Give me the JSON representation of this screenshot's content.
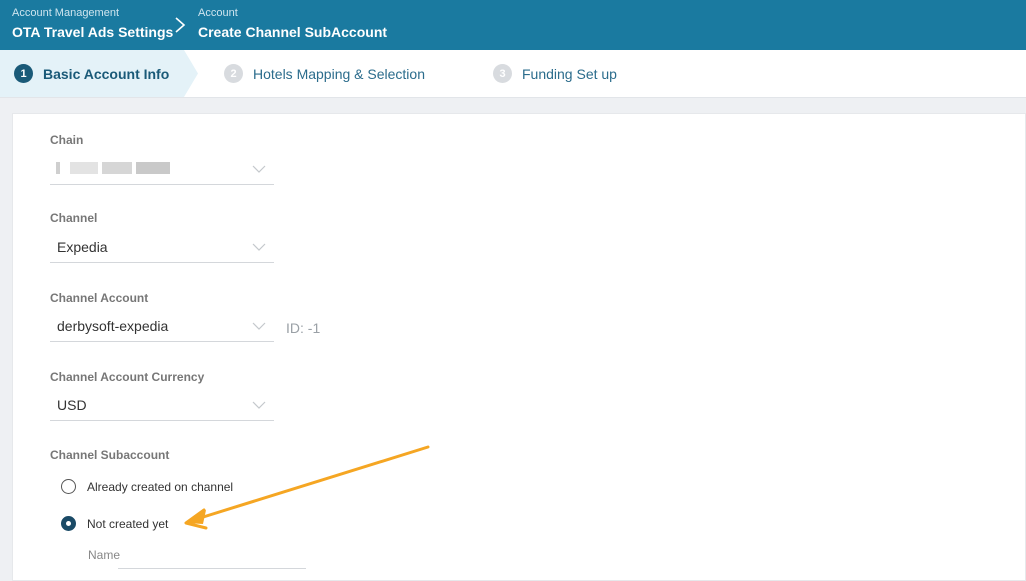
{
  "header": {
    "crumb1_small": "Account Management",
    "crumb1_big": "OTA Travel Ads Settings",
    "crumb2_small": "Account",
    "crumb2_big": "Create Channel SubAccount"
  },
  "steps": [
    {
      "num": "1",
      "label": "Basic Account Info",
      "active": true
    },
    {
      "num": "2",
      "label": "Hotels Mapping & Selection",
      "active": false
    },
    {
      "num": "3",
      "label": "Funding Set up",
      "active": false
    }
  ],
  "form": {
    "chain_label": "Chain",
    "channel_label": "Channel",
    "channel_value": "Expedia",
    "account_label": "Channel Account",
    "account_value": "derbysoft-expedia",
    "account_id": "ID: -1",
    "currency_label": "Channel Account Currency",
    "currency_value": "USD",
    "subaccount_label": "Channel Subaccount",
    "option_created": "Already created on channel",
    "option_not_created": "Not created yet",
    "name_label": "Name",
    "selected_option": "Not created yet"
  },
  "colors": {
    "header_bg": "#1a7aa0",
    "active_step": "#1a5a78",
    "annotation_arrow": "#f5a623"
  }
}
